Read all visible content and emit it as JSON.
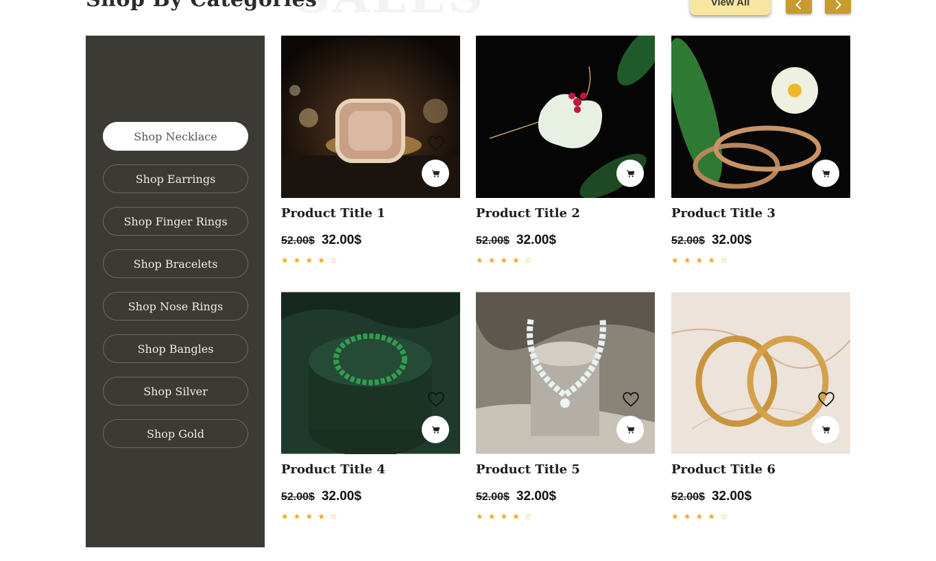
{
  "section": {
    "title": "Shop By Categories",
    "ghost_title": "SALES",
    "view_all_label": "View All",
    "prev_icon": "chevron-left-icon",
    "next_icon": "chevron-right-icon"
  },
  "sidebar": {
    "items": [
      {
        "label": "Shop Necklace",
        "active": true
      },
      {
        "label": "Shop Earrings",
        "active": false
      },
      {
        "label": "Shop Finger Rings",
        "active": false
      },
      {
        "label": "Shop Bracelets",
        "active": false
      },
      {
        "label": "Shop Nose Rings",
        "active": false
      },
      {
        "label": "Shop Bangles",
        "active": false
      },
      {
        "label": "Shop Silver",
        "active": false
      },
      {
        "label": "Shop Gold",
        "active": false
      }
    ]
  },
  "products": [
    {
      "title": "Product Title 1",
      "old_price": "52.00$",
      "price": "32.00$",
      "rating": 4,
      "rating_max": 5,
      "image": "pink gemstone ring on dark background"
    },
    {
      "title": "Product Title 2",
      "old_price": "52.00$",
      "price": "32.00$",
      "rating": 4,
      "rating_max": 5,
      "image": "jade heart pendant necklace with red flower"
    },
    {
      "title": "Product Title 3",
      "old_price": "52.00$",
      "price": "32.00$",
      "rating": 4,
      "rating_max": 5,
      "image": "gold chain bracelets with white flower"
    },
    {
      "title": "Product Title 4",
      "old_price": "52.00$",
      "price": "32.00$",
      "rating": 4,
      "rating_max": 5,
      "image": "emerald bracelet on green velvet stand"
    },
    {
      "title": "Product Title 5",
      "old_price": "52.00$",
      "price": "32.00$",
      "rating": 4,
      "rating_max": 5,
      "image": "opal bead necklace on stone pedestal"
    },
    {
      "title": "Product Title 6",
      "old_price": "52.00$",
      "price": "32.00$",
      "rating": 4,
      "rating_max": 5,
      "image": "gold hoop rings on marble"
    }
  ],
  "colors": {
    "sidebar_bg": "#3c3a35",
    "accent": "#c99a2e",
    "view_all_bg": "#f8e6a0",
    "star": "#f2a81d"
  }
}
